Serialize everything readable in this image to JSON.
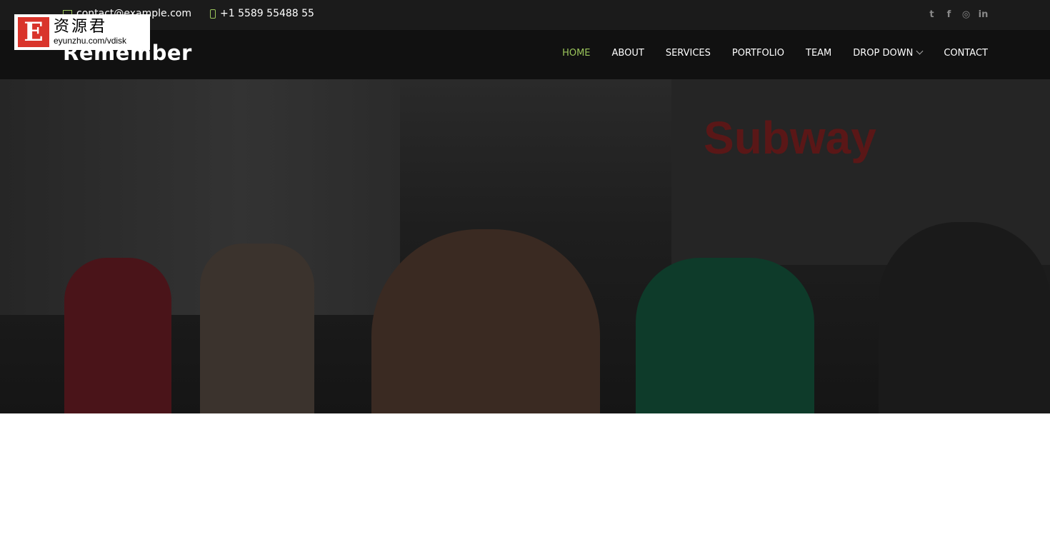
{
  "topbar": {
    "email": "contact@example.com",
    "phone": "+1 5589 55488 55",
    "email_icon": "envelope-icon",
    "phone_icon": "phone-icon",
    "social": [
      {
        "name": "twitter-icon",
        "glyph": "t"
      },
      {
        "name": "facebook-icon",
        "glyph": "f"
      },
      {
        "name": "instagram-icon",
        "glyph": "◎"
      },
      {
        "name": "linkedin-icon",
        "glyph": "in"
      }
    ]
  },
  "header": {
    "logo": "Remember",
    "nav": [
      {
        "label": "HOME",
        "active": true
      },
      {
        "label": "ABOUT"
      },
      {
        "label": "SERVICES"
      },
      {
        "label": "PORTFOLIO"
      },
      {
        "label": "TEAM"
      },
      {
        "label": "DROP DOWN"
      },
      {
        "label": "CONTACT"
      }
    ]
  },
  "hero": {
    "sign_text": "Subway"
  },
  "watermark": {
    "letter": "E",
    "title": "资源君",
    "url": "eyunzhu.com/vdisk"
  },
  "colors": {
    "accent": "#9bc55b",
    "topbar": "#1b1b1b",
    "header": "#111111"
  }
}
